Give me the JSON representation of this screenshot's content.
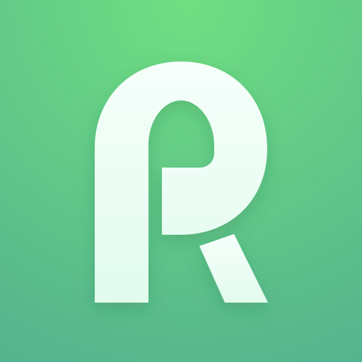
{
  "app_icon": {
    "logo_letter": "R",
    "logo_icon": "stylized-letter-r-icon",
    "colors": {
      "background_top": "#6fdf82",
      "background_bottom": "#55b38e",
      "glyph_top": "#f6fffb",
      "glyph_bottom": "#e2fbee",
      "shadow": "#1f6a45"
    }
  }
}
